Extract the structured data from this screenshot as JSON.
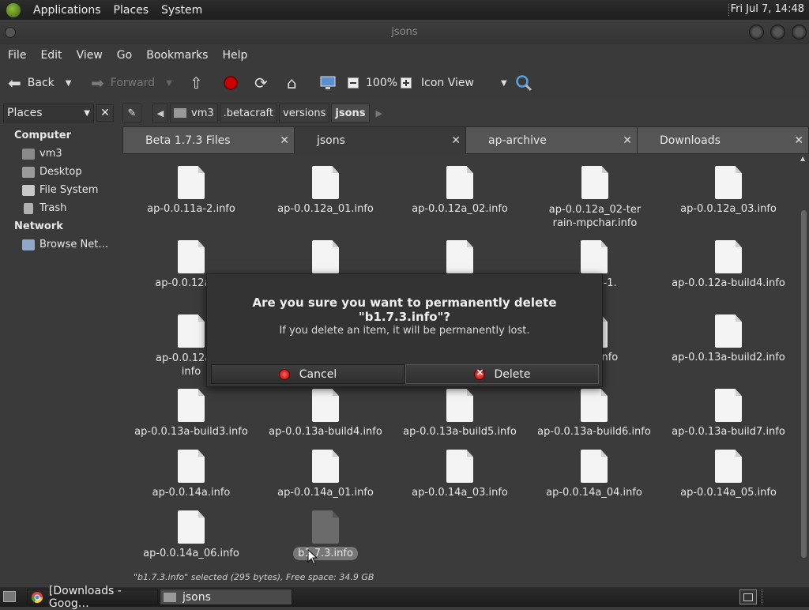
{
  "top_panel": {
    "menus": [
      "Applications",
      "Places",
      "System"
    ],
    "clock": "Fri Jul 7, 14:48"
  },
  "window": {
    "title": "jsons"
  },
  "menubar": [
    "File",
    "Edit",
    "View",
    "Go",
    "Bookmarks",
    "Help"
  ],
  "toolbar": {
    "back": "Back",
    "forward": "Forward",
    "zoom": "100%",
    "view_mode": "Icon View"
  },
  "sidebar": {
    "selector": "Places",
    "sections": [
      {
        "title": "Computer",
        "items": [
          "vm3",
          "Desktop",
          "File System",
          "Trash"
        ]
      },
      {
        "title": "Network",
        "items": [
          "Browse Net…"
        ]
      }
    ]
  },
  "pathbar": [
    "vm3",
    ".betacraft",
    "versions",
    "jsons"
  ],
  "tabs": [
    {
      "label": "Beta 1.7.3 Files",
      "active": false
    },
    {
      "label": "jsons",
      "active": true
    },
    {
      "label": "ap-archive",
      "active": false
    },
    {
      "label": "Downloads",
      "active": false
    }
  ],
  "files": [
    "ap-0.0.11a-2.info",
    "ap-0.0.12a_01.info",
    "ap-0.0.12a_02.info",
    "ap-0.0.12a_02-terrain-mpchar.info",
    "ap-0.0.12a_03.info",
    "ap-0.0.12a-bu",
    "",
    "",
    "build3-1.",
    "ap-0.0.12a-build4.info",
    "ap-0.0.12a-MI info",
    "",
    "",
    "uild1.info",
    "ap-0.0.13a-build2.info",
    "ap-0.0.13a-build3.info",
    "ap-0.0.13a-build4.info",
    "ap-0.0.13a-build5.info",
    "ap-0.0.13a-build6.info",
    "ap-0.0.13a-build7.info",
    "ap-0.0.14a.info",
    "ap-0.0.14a_01.info",
    "ap-0.0.14a_03.info",
    "ap-0.0.14a_04.info",
    "ap-0.0.14a_05.info",
    "ap-0.0.14a_06.info",
    "b1.7.3.info"
  ],
  "status": "\"b1.7.3.info\" selected (295 bytes), Free space: 34.9 GB",
  "dialog": {
    "title": "Are you sure you want to permanently delete \"b1.7.3.info\"?",
    "message": "If you delete an item, it will be permanently lost.",
    "cancel": "Cancel",
    "delete": "Delete"
  },
  "taskbar": [
    {
      "label": "[Downloads - Goog…",
      "icon": "chrome-icon"
    },
    {
      "label": "jsons",
      "icon": "folder-icon"
    }
  ]
}
